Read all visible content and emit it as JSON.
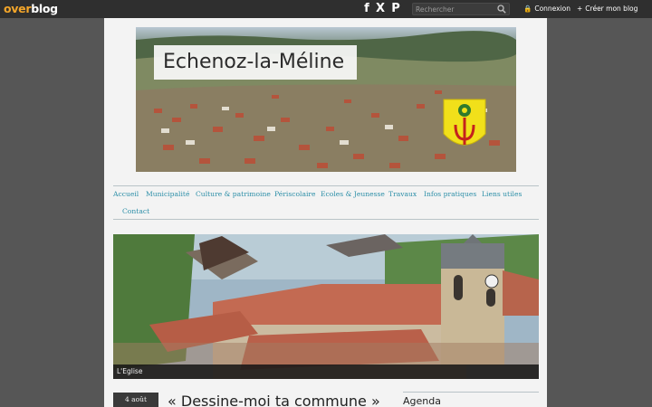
{
  "topbar": {
    "logo_left": "over",
    "logo_right": "blog",
    "search_placeholder": "Rechercher",
    "connexion_label": "Connexion",
    "creer_label": "Créer mon blog",
    "social": [
      "f",
      "X",
      "P"
    ]
  },
  "header": {
    "title": "Echenoz-la-Méline"
  },
  "nav": {
    "items": [
      "Accueil",
      "Municipalité",
      "Culture & patrimoine",
      "Périscolaire",
      "Ecoles & Jeunesse",
      "Travaux",
      "Infos pratiques",
      "Liens utiles",
      "Contact"
    ]
  },
  "slideshow": {
    "caption": "L'Eglise"
  },
  "post": {
    "date": "4 août",
    "title": "« Dessine-moi ta commune »"
  },
  "sidebar": {
    "agenda_title": "Agenda"
  },
  "colors": {
    "topbar": "#2f2f2f",
    "background": "#565656",
    "page": "#f3f3f3",
    "nav_link": "#2d8fa8",
    "logo_accent": "#f4a62a"
  }
}
